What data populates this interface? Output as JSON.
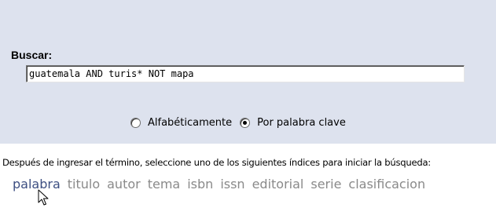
{
  "search": {
    "label": "Buscar:",
    "query": "guatemala AND turis* NOT mapa"
  },
  "sort_options": [
    {
      "label": "Alfabéticamente",
      "selected": false
    },
    {
      "label": "Por palabra clave",
      "selected": true
    }
  ],
  "instruction": "Después de ingresar el término, seleccione uno de los siguientes índices para iniciar la búsqueda:",
  "indexes": [
    {
      "label": "palabra",
      "active": true
    },
    {
      "label": "titulo",
      "active": false
    },
    {
      "label": "autor",
      "active": false
    },
    {
      "label": "tema",
      "active": false
    },
    {
      "label": "isbn",
      "active": false
    },
    {
      "label": "issn",
      "active": false
    },
    {
      "label": "editorial",
      "active": false
    },
    {
      "label": "serie",
      "active": false
    },
    {
      "label": "clasificacion",
      "active": false
    }
  ],
  "colors": {
    "panel_background": "#dde2ee",
    "index_active": "#3d4f82",
    "index_inactive": "#8a8a8a"
  },
  "icons": {
    "cursor": "arrow-cursor-icon"
  }
}
